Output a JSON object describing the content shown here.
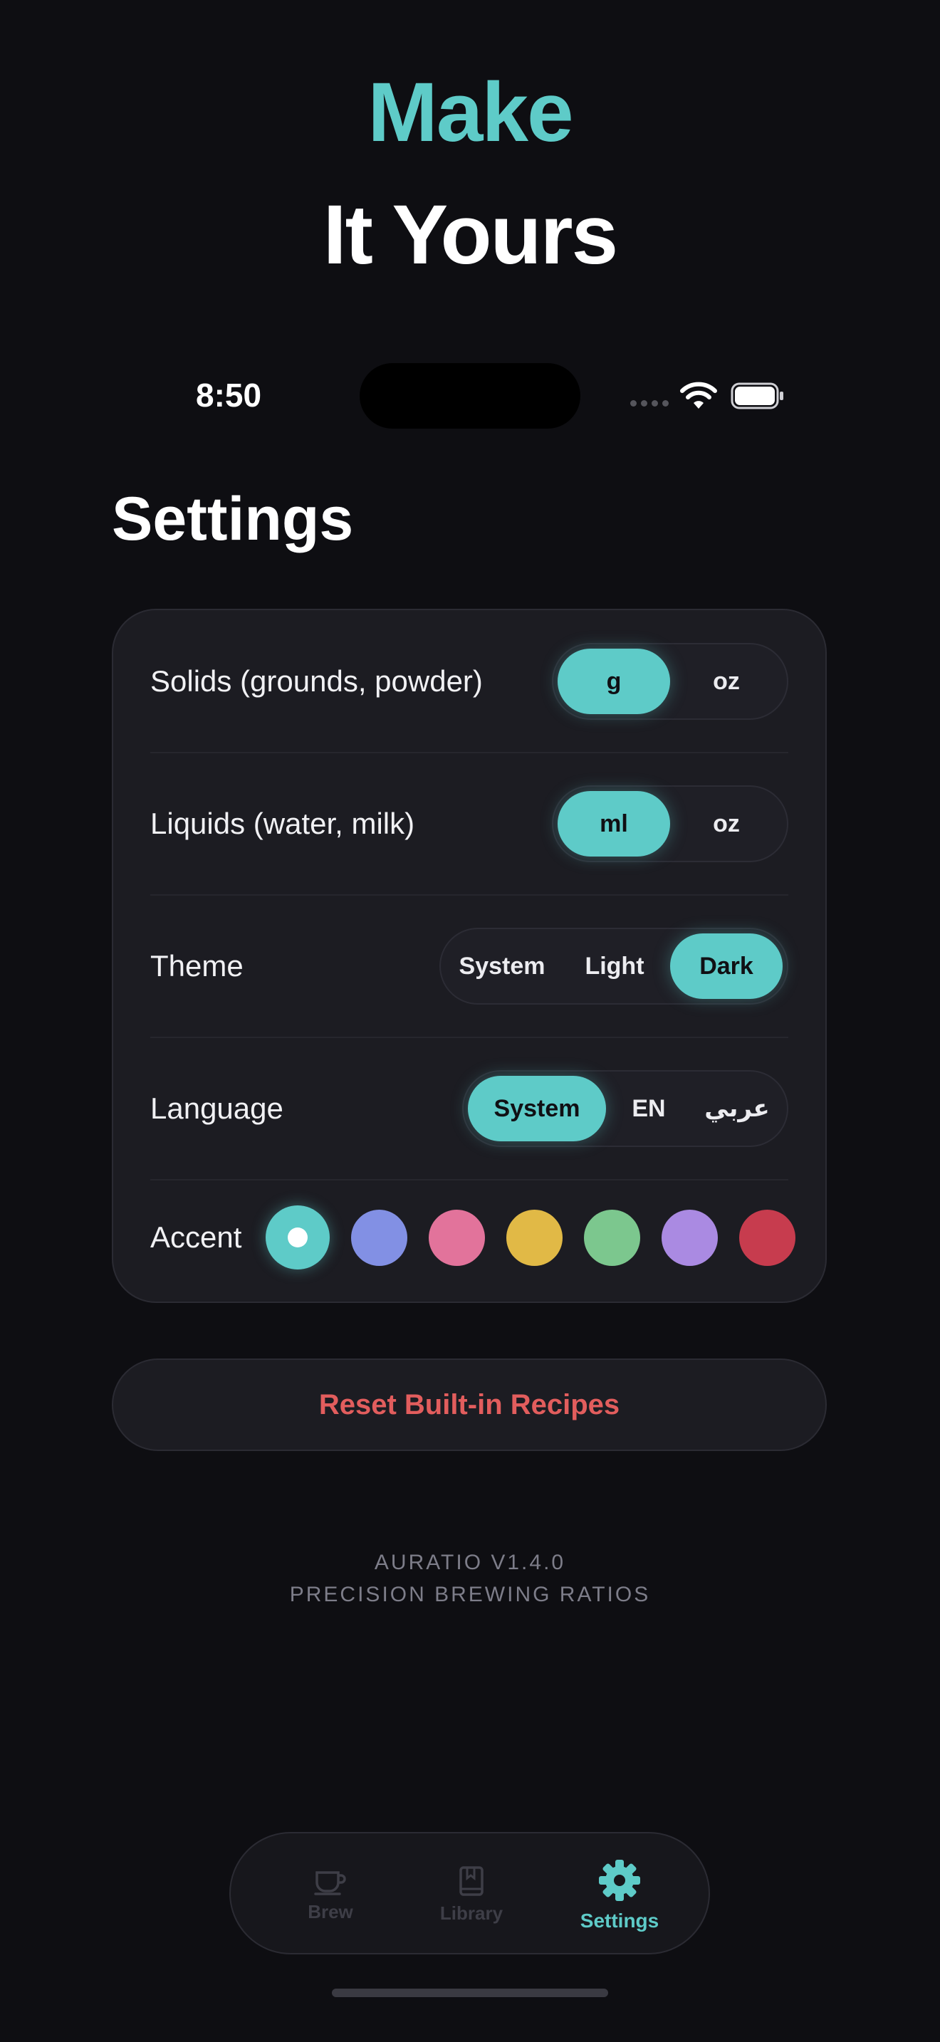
{
  "hero": {
    "line1": "Make",
    "line2": "It Yours"
  },
  "status_bar": {
    "time": "8:50"
  },
  "page_title": "Settings",
  "settings": {
    "solids": {
      "label": "Solids (grounds, powder)",
      "options": [
        "g",
        "oz"
      ],
      "selected": "g"
    },
    "liquids": {
      "label": "Liquids (water, milk)",
      "options": [
        "ml",
        "oz"
      ],
      "selected": "ml"
    },
    "theme": {
      "label": "Theme",
      "options": [
        "System",
        "Light",
        "Dark"
      ],
      "selected": "Dark"
    },
    "language": {
      "label": "Language",
      "options": [
        "System",
        "EN",
        "عربي"
      ],
      "selected": "System"
    },
    "accent": {
      "label": "Accent",
      "colors": [
        "#5ecbc8",
        "#8290e4",
        "#e2739b",
        "#e1b946",
        "#7cc78e",
        "#aa8ae2",
        "#c73c4e"
      ],
      "selected_index": 0
    }
  },
  "reset_button": "Reset Built-in Recipes",
  "footer": {
    "version": "AURATIO V1.4.0",
    "tagline": "PRECISION BREWING RATIOS"
  },
  "tabbar": {
    "tabs": [
      {
        "label": "Brew",
        "icon": "coffee-cup-icon"
      },
      {
        "label": "Library",
        "icon": "bookmark-book-icon"
      },
      {
        "label": "Settings",
        "icon": "gear-icon"
      }
    ],
    "active": "Settings"
  },
  "colors": {
    "accent": "#5ecbc8",
    "background": "#0e0e12",
    "card": "#1c1c22",
    "danger": "#e25d5d"
  }
}
